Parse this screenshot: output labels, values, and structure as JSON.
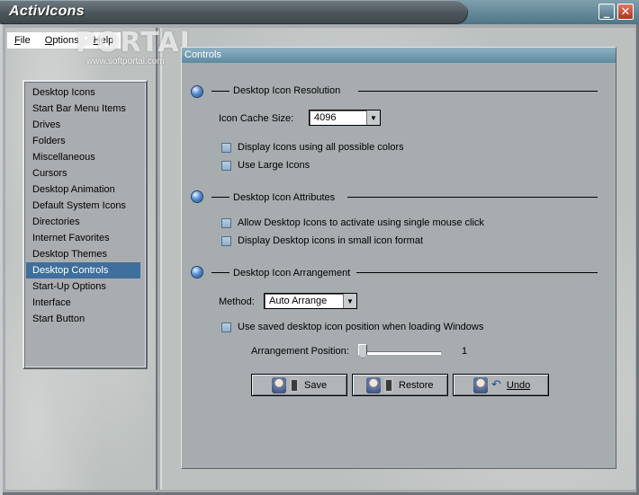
{
  "app": {
    "title": "ActivIcons"
  },
  "window_buttons": {
    "minimize": "_",
    "close": "✕"
  },
  "menu": [
    "File",
    "Options",
    "Help"
  ],
  "watermark": {
    "text": "PORTAL",
    "url": "www.softportal.com"
  },
  "nav": {
    "items": [
      "Desktop Icons",
      "Start Bar Menu Items",
      "Drives",
      "Folders",
      "Miscellaneous",
      "Cursors",
      "Desktop Animation",
      "Default System Icons",
      "Directories",
      "Internet Favorites",
      "Desktop Themes",
      "Desktop Controls",
      "Start-Up Options",
      "Interface",
      "Start Button"
    ],
    "selected": "Desktop Controls",
    "selected_color": "#3f6f9c"
  },
  "panel": {
    "title": "Controls",
    "resolution": {
      "title": "Desktop Icon Resolution",
      "cache_label": "Icon Cache Size:",
      "cache_value": "4096",
      "checkboxes": [
        "Display Icons using all possible colors",
        "Use Large Icons"
      ]
    },
    "attributes": {
      "title": "Desktop Icon Attributes",
      "checkboxes": [
        "Allow Desktop Icons to activate using single mouse click",
        "Display Desktop icons in small icon format"
      ]
    },
    "arrangement": {
      "title": "Desktop Icon Arrangement",
      "method_label": "Method:",
      "method_value": "Auto Arrange",
      "checkbox": "Use saved desktop icon position when loading Windows",
      "position_label": "Arrangement Position:",
      "position_value": "1"
    },
    "buttons": {
      "save": "Save",
      "restore": "Restore",
      "undo": "Undo"
    }
  },
  "icons": {
    "bullet": "blue-orb-bullet-icon",
    "combo_arrow": "triangle-down-icon",
    "undo": "undo-arrow-icon",
    "face": "user-face-icon",
    "doc": "document-icon"
  }
}
